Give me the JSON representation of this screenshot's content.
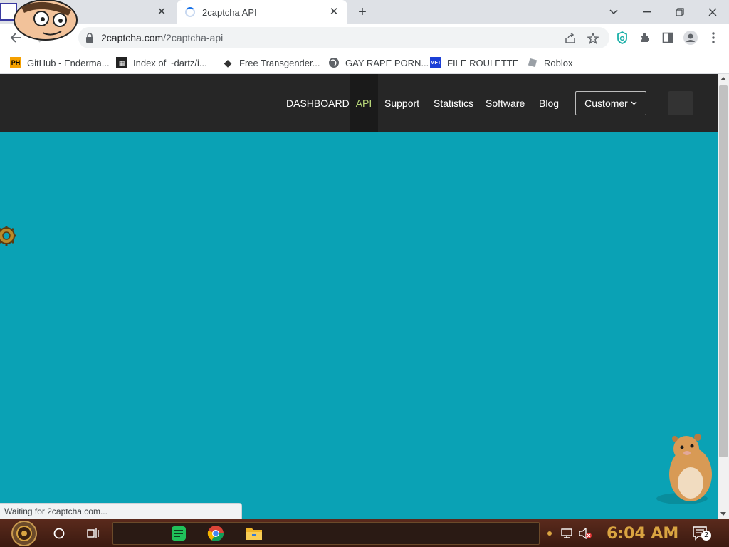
{
  "browser": {
    "tabs": [
      {
        "title": "",
        "active": false
      },
      {
        "title": "2captcha API",
        "active": true
      }
    ],
    "url": {
      "domain": "2captcha.com",
      "path": "/2captcha-api"
    },
    "bookmarks": [
      {
        "label": "GitHub - Enderma...",
        "icon": "ph-badge-icon"
      },
      {
        "label": "Index of ~dartz/i...",
        "icon": "qr-favicon-icon"
      },
      {
        "label": "Free Transgender...",
        "icon": "fox-favicon-icon"
      },
      {
        "label": "GAY RAPE PORN...",
        "icon": "globe-icon"
      },
      {
        "label": "FILE ROULETTE",
        "icon": "mft-favicon-icon"
      },
      {
        "label": "Roblox",
        "icon": "roblox-icon"
      }
    ],
    "status_text": "Waiting for 2captcha.com..."
  },
  "site": {
    "nav": [
      {
        "label": "DASHBOARD",
        "active": false
      },
      {
        "label": "API",
        "active": true
      },
      {
        "label": "Support",
        "active": false
      },
      {
        "label": "Statistics",
        "active": false
      },
      {
        "label": "Software",
        "active": false
      },
      {
        "label": "Blog",
        "active": false
      }
    ],
    "customer_label": "Customer",
    "colors": {
      "header": "#262626",
      "body": "#0aa2b5",
      "active_link": "#b9d97a"
    }
  },
  "taskbar": {
    "clock": "6:04 AM",
    "notification_count": "2"
  }
}
